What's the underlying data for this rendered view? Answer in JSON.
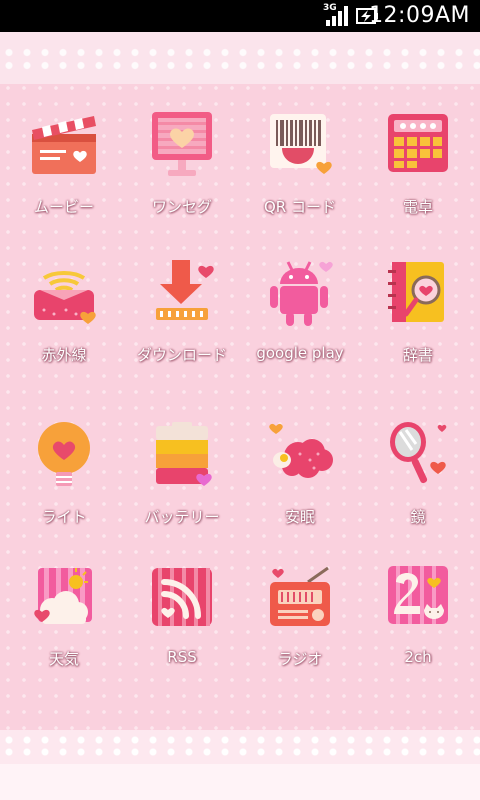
{
  "status_bar": {
    "network_type": "3G",
    "time": "12:09AM"
  },
  "apps": [
    {
      "label": "ムービー",
      "icon": "clapperboard-icon"
    },
    {
      "label": "ワンセグ",
      "icon": "tv-heart-icon"
    },
    {
      "label": "QR コード",
      "icon": "qr-barcode-icon"
    },
    {
      "label": "電卓",
      "icon": "calculator-icon"
    },
    {
      "label": "赤外線",
      "icon": "infrared-pouch-icon"
    },
    {
      "label": "ダウンロード",
      "icon": "download-arrow-icon"
    },
    {
      "label": "google play",
      "icon": "android-robot-icon"
    },
    {
      "label": "辞書",
      "icon": "dictionary-book-icon"
    },
    {
      "label": "ライト",
      "icon": "light-bulb-icon"
    },
    {
      "label": "バッテリー",
      "icon": "battery-icon"
    },
    {
      "label": "安眠",
      "icon": "sleep-sheep-icon"
    },
    {
      "label": "鏡",
      "icon": "hand-mirror-icon"
    },
    {
      "label": "天気",
      "icon": "weather-sun-cloud-icon"
    },
    {
      "label": "RSS",
      "icon": "rss-feed-icon"
    },
    {
      "label": "ラジオ",
      "icon": "radio-icon"
    },
    {
      "label": "2ch",
      "icon": "2ch-cat-icon"
    }
  ],
  "colors": {
    "wallpaper": "#fad1de",
    "accent_pink": "#f0608a",
    "accent_orange": "#f7a13a"
  }
}
